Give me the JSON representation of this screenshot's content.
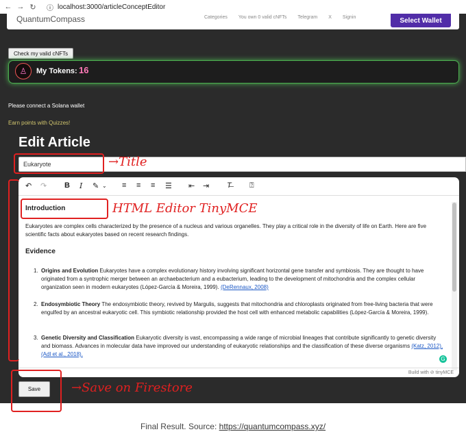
{
  "browser": {
    "url": "localhost:3000/articleConceptEditor"
  },
  "navbar": {
    "brand": "QuantumCompass",
    "links": [
      "Categories",
      "You own 0 valid cNFTs",
      "Telegram",
      "X",
      "Signin"
    ],
    "wallet_button": "Select Wallet"
  },
  "cnft_button": "Check my valid cNFTs",
  "tokens": {
    "label": "My Tokens:",
    "count": "16"
  },
  "connect_msg": "Please connect a Solana wallet",
  "earn_link": "Earn points with Quizzes!",
  "heading": "Edit Article",
  "title_input": {
    "value": "Eukaryote"
  },
  "editor": {
    "h2": "Introduction",
    "intro": "Eukaryotes are complex cells characterized by the presence of a nucleus and various organelles. They play a critical role in the diversity of life on Earth. Here are five scientific facts about eukaryotes based on recent research findings.",
    "h3": "Evidence",
    "items": [
      {
        "num": "1.",
        "title": "Origins and Evolution",
        "text": "Eukaryotes have a complex evolutionary history involving significant horizontal gene transfer and symbiosis. They are thought to have originated from a syntrophic merger between an archaebacterium and a eubacterium, leading to the development of mitochondria and the complex cellular organization seen in modern eukaryotes (López-García & Moreira, 1999).",
        "cite": "(DeRennaux, 2008)"
      },
      {
        "num": "2.",
        "title": "Endosymbiotic Theory",
        "text": "The endosymbiotic theory, revived by Margulis, suggests that mitochondria and chloroplasts originated from free-living bacteria that were engulfed by an ancestral eukaryotic cell. This symbiotic relationship provided the host cell with enhanced metabolic capabilities (López-García & Moreira, 1999).",
        "cite": ""
      },
      {
        "num": "3.",
        "title": "Genetic Diversity and Classification",
        "text": "Eukaryotic diversity is vast, encompassing a wide range of microbial lineages that contribute significantly to genetic diversity and biomass. Advances in molecular data have improved our understanding of eukaryotic relationships and the classification of these diverse organisms",
        "cite": "(Katz, 2012), (Adl et al., 2018)."
      }
    ],
    "status": "Build with ⊘ tinyMCE"
  },
  "save_button": "Save",
  "annotations": {
    "title": "→Title",
    "editor": "HTML Editor TinyMCE",
    "save": "→Save on Firestore"
  },
  "caption": {
    "prefix": "Final Result. Source: ",
    "link": "https://quantumcompass.xyz/"
  },
  "colors": {
    "accent": "#512da8",
    "annotation": "#e02020",
    "token_border": "#4caf50"
  }
}
